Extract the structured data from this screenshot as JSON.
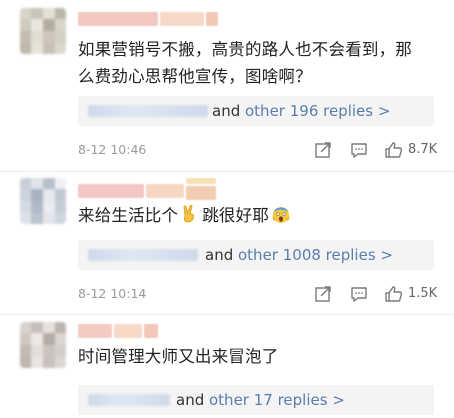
{
  "comments": [
    {
      "text": "如果营销号不搬，高贵的路人也不会看到，那么费劲心思帮他宣传，图啥啊？",
      "replies": {
        "prefix": "and ",
        "link": "other 196 replies >"
      },
      "time": "8-12 10:46",
      "likes": "8.7K",
      "avatar_colors": [
        "#d8d4c9",
        "#c9c4b8",
        "#e4e0d6",
        "#bdb6a8",
        "#cfcbbf",
        "#e9e6df",
        "#b5aea0",
        "#dad6cc",
        "#c4bdb0",
        "#e1ddd3",
        "#cdc7bb",
        "#d4d0c5",
        "#bfb9ad",
        "#e7e3db",
        "#c8c2b6",
        "#dcd8ce"
      ],
      "name_colors": [
        "#f3c6c0",
        "#f6d8c9",
        "#f2c8b5",
        "#f7d9b0"
      ]
    },
    {
      "text_before": "来给生活比个",
      "text_middle": "跳很好耶",
      "replies": {
        "prefix": "and ",
        "link": "other 1008 replies >"
      },
      "time": "8-12 10:14",
      "likes": "1.5K",
      "avatar_colors": [
        "#c8ced8",
        "#dfe3ea",
        "#b8c0cc",
        "#eef0f3",
        "#cdd3dc",
        "#a9b3c1",
        "#e5e8ed",
        "#c2c9d3",
        "#d6dbe3",
        "#b1bac7",
        "#e9ecf0",
        "#c6ccd6",
        "#dce0e7",
        "#bcc4cf",
        "#e2e5eb",
        "#cfd5de"
      ],
      "name_colors": [
        "#f4c6c4",
        "#f6d7c4",
        "#f3cdb2",
        "#f5e1b4"
      ]
    },
    {
      "text": "时间管理大师又出来冒泡了",
      "replies": {
        "prefix": "and ",
        "link": "other 17 replies >"
      },
      "avatar_colors": [
        "#d9d3cf",
        "#c7bfba",
        "#e6e1de",
        "#bdb3ad",
        "#cfc7c2",
        "#ece8e6",
        "#b6aca6",
        "#dcd6d2",
        "#c3bab5",
        "#e3deda",
        "#cbc3be",
        "#d5cec9",
        "#bfb6b0",
        "#e9e5e2",
        "#c9c1bc",
        "#ddd7d3"
      ],
      "name_colors": [
        "#f3cbc2",
        "#f6d9c6",
        "#f1c7b9"
      ]
    }
  ],
  "colors": {
    "link": "#5b7dae",
    "time": "#9a9a9a",
    "icon": "#7a7a7a"
  }
}
